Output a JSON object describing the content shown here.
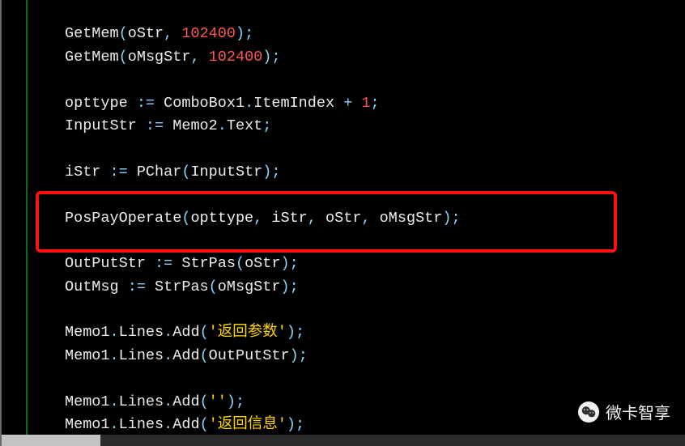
{
  "code": {
    "lines": [
      {
        "raw": "",
        "blank": true
      },
      {
        "tokens": [
          [
            "indent",
            ""
          ],
          [
            "id",
            "GetMem"
          ],
          [
            "punc",
            "("
          ],
          [
            "id",
            "oStr"
          ],
          [
            "punc",
            ", "
          ],
          [
            "num",
            "102400"
          ],
          [
            "punc",
            ")"
          ],
          [
            "punc",
            ";"
          ]
        ]
      },
      {
        "tokens": [
          [
            "indent",
            ""
          ],
          [
            "id",
            "GetMem"
          ],
          [
            "punc",
            "("
          ],
          [
            "id",
            "oMsgStr"
          ],
          [
            "punc",
            ", "
          ],
          [
            "num",
            "102400"
          ],
          [
            "punc",
            ")"
          ],
          [
            "punc",
            ";"
          ]
        ]
      },
      {
        "raw": "",
        "blank": true
      },
      {
        "tokens": [
          [
            "indent",
            ""
          ],
          [
            "id",
            "opttype "
          ],
          [
            "punc",
            ":= "
          ],
          [
            "id",
            "ComboBox1"
          ],
          [
            "punc",
            "."
          ],
          [
            "id",
            "ItemIndex "
          ],
          [
            "punc",
            "+ "
          ],
          [
            "num",
            "1"
          ],
          [
            "punc",
            ";"
          ]
        ]
      },
      {
        "tokens": [
          [
            "indent",
            ""
          ],
          [
            "id",
            "InputStr "
          ],
          [
            "punc",
            ":= "
          ],
          [
            "id",
            "Memo2"
          ],
          [
            "punc",
            "."
          ],
          [
            "id",
            "Text"
          ],
          [
            "punc",
            ";"
          ]
        ]
      },
      {
        "raw": "",
        "blank": true
      },
      {
        "tokens": [
          [
            "indent",
            ""
          ],
          [
            "id",
            "iStr "
          ],
          [
            "punc",
            ":= "
          ],
          [
            "id",
            "PChar"
          ],
          [
            "punc",
            "("
          ],
          [
            "id",
            "InputStr"
          ],
          [
            "punc",
            ")"
          ],
          [
            "punc",
            ";"
          ]
        ]
      },
      {
        "raw": "",
        "blank": true
      },
      {
        "tokens": [
          [
            "indent",
            ""
          ],
          [
            "id",
            "PosPayOperate"
          ],
          [
            "punc",
            "("
          ],
          [
            "id",
            "opttype"
          ],
          [
            "punc",
            ", "
          ],
          [
            "id",
            "iStr"
          ],
          [
            "punc",
            ", "
          ],
          [
            "id",
            "oStr"
          ],
          [
            "punc",
            ", "
          ],
          [
            "id",
            "oMsgStr"
          ],
          [
            "punc",
            ")"
          ],
          [
            "punc",
            ";"
          ]
        ]
      },
      {
        "raw": "",
        "blank": true
      },
      {
        "tokens": [
          [
            "indent",
            ""
          ],
          [
            "id",
            "OutPutStr "
          ],
          [
            "punc",
            ":= "
          ],
          [
            "id",
            "StrPas"
          ],
          [
            "punc",
            "("
          ],
          [
            "id",
            "oStr"
          ],
          [
            "punc",
            ")"
          ],
          [
            "punc",
            ";"
          ]
        ]
      },
      {
        "tokens": [
          [
            "indent",
            ""
          ],
          [
            "id",
            "OutMsg "
          ],
          [
            "punc",
            ":= "
          ],
          [
            "id",
            "StrPas"
          ],
          [
            "punc",
            "("
          ],
          [
            "id",
            "oMsgStr"
          ],
          [
            "punc",
            ")"
          ],
          [
            "punc",
            ";"
          ]
        ]
      },
      {
        "raw": "",
        "blank": true
      },
      {
        "tokens": [
          [
            "indent",
            ""
          ],
          [
            "id",
            "Memo1"
          ],
          [
            "punc",
            "."
          ],
          [
            "id",
            "Lines"
          ],
          [
            "punc",
            "."
          ],
          [
            "id",
            "Add"
          ],
          [
            "punc",
            "("
          ],
          [
            "str",
            "'返回参数'"
          ],
          [
            "punc",
            ")"
          ],
          [
            "punc",
            ";"
          ]
        ]
      },
      {
        "tokens": [
          [
            "indent",
            ""
          ],
          [
            "id",
            "Memo1"
          ],
          [
            "punc",
            "."
          ],
          [
            "id",
            "Lines"
          ],
          [
            "punc",
            "."
          ],
          [
            "id",
            "Add"
          ],
          [
            "punc",
            "("
          ],
          [
            "id",
            "OutPutStr"
          ],
          [
            "punc",
            ")"
          ],
          [
            "punc",
            ";"
          ]
        ]
      },
      {
        "raw": "",
        "blank": true
      },
      {
        "tokens": [
          [
            "indent",
            ""
          ],
          [
            "id",
            "Memo1"
          ],
          [
            "punc",
            "."
          ],
          [
            "id",
            "Lines"
          ],
          [
            "punc",
            "."
          ],
          [
            "id",
            "Add"
          ],
          [
            "punc",
            "("
          ],
          [
            "str",
            "''"
          ],
          [
            "punc",
            ")"
          ],
          [
            "punc",
            ";"
          ]
        ]
      },
      {
        "tokens": [
          [
            "indent",
            ""
          ],
          [
            "id",
            "Memo1"
          ],
          [
            "punc",
            "."
          ],
          [
            "id",
            "Lines"
          ],
          [
            "punc",
            "."
          ],
          [
            "id",
            "Add"
          ],
          [
            "punc",
            "("
          ],
          [
            "str",
            "'返回信息'"
          ],
          [
            "punc",
            ")"
          ],
          [
            "punc",
            ";"
          ]
        ]
      }
    ]
  },
  "highlight": {
    "line_index": 9
  },
  "watermark": {
    "text": "微卡智享",
    "icon": "wechat-icon"
  },
  "scrollbar": {
    "thumb_width_ratio": 0.144
  }
}
